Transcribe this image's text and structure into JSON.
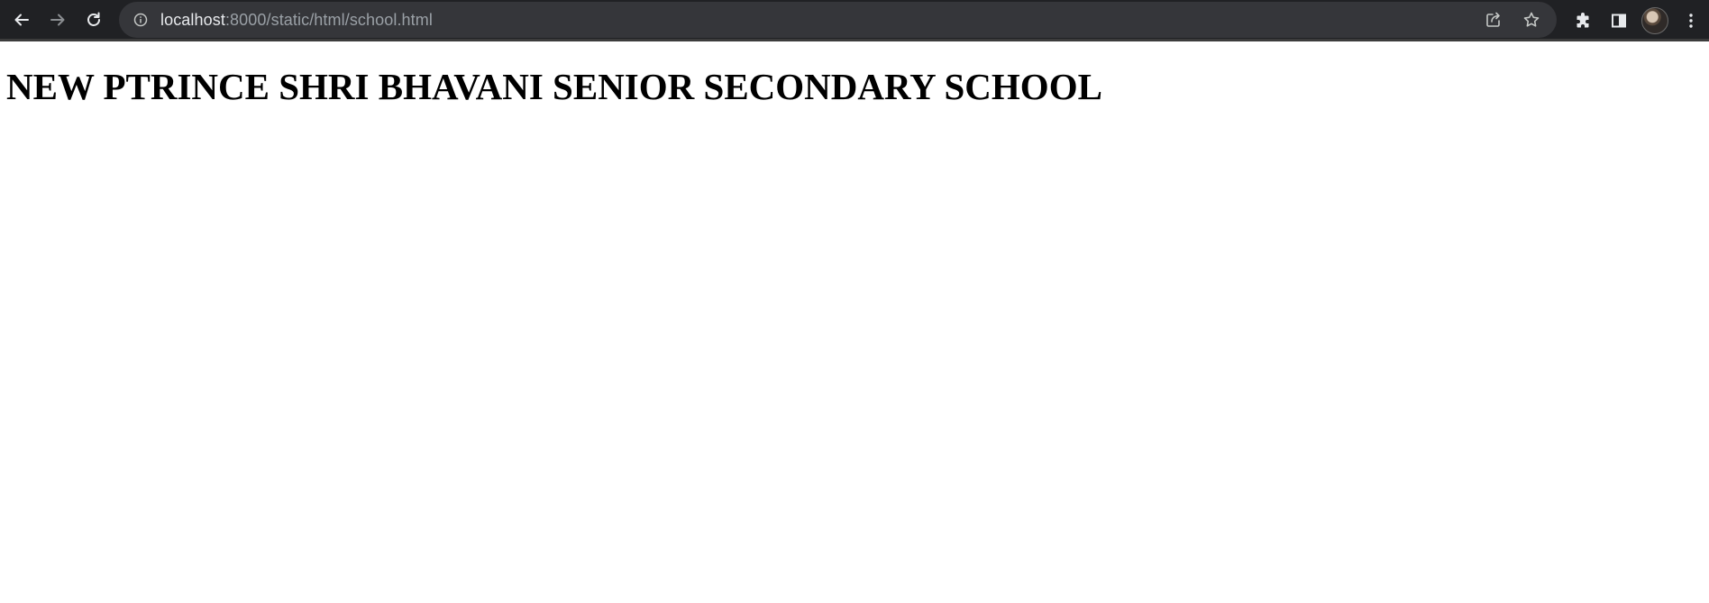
{
  "browser": {
    "url_host": "localhost",
    "url_rest": ":8000/static/html/school.html",
    "colors": {
      "toolbar_bg": "#202124",
      "omnibox_bg": "#35363a",
      "url_host": "#e8eaed",
      "url_rest": "#9aa0a6"
    },
    "icons": {
      "back": "back-arrow-icon",
      "forward": "forward-arrow-icon",
      "reload": "reload-icon",
      "site_info": "info-icon",
      "share": "share-icon",
      "bookmark": "star-icon",
      "extensions": "puzzle-icon",
      "side_panel": "side-panel-icon",
      "profile": "avatar",
      "menu": "kebab-menu-icon"
    }
  },
  "page": {
    "title": "NEW PTRINCE SHRI BHAVANI SENIOR SECONDARY SCHOOL"
  }
}
